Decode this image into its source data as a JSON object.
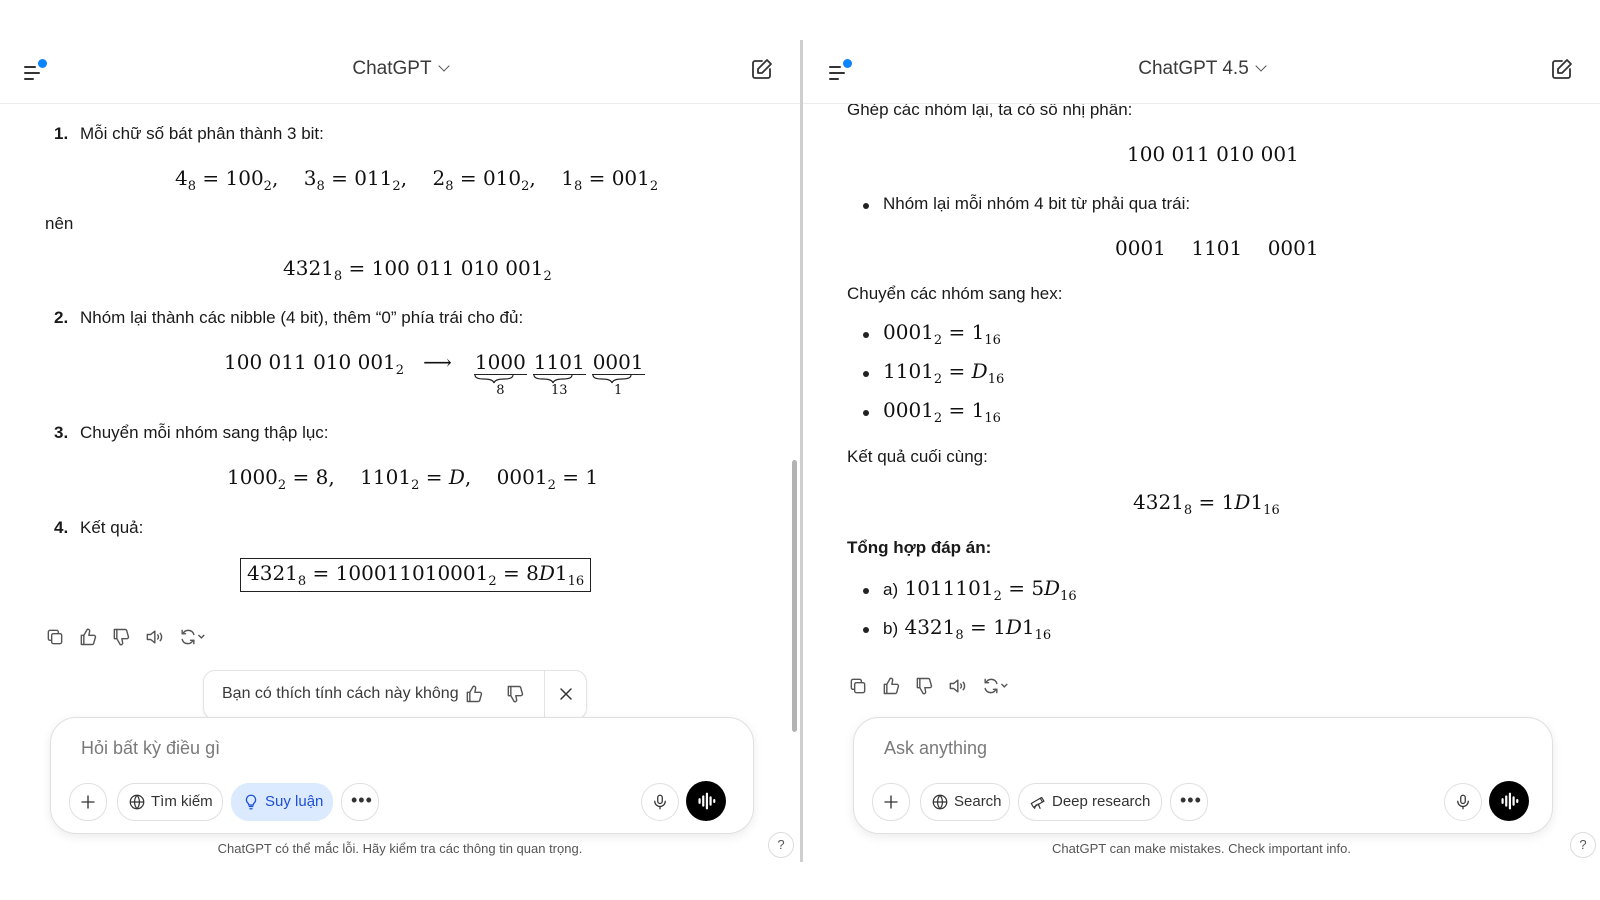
{
  "left": {
    "model": "ChatGPT",
    "step1": {
      "num": "1.",
      "text": "Mỗi chữ số bát phân thành 3 bit:"
    },
    "nen": "nên",
    "step2": {
      "num": "2.",
      "text": "Nhóm lại thành các nibble (4 bit), thêm “0” phía trái cho đủ:"
    },
    "step3": {
      "num": "3.",
      "text": "Chuyển mỗi nhóm sang thập lục:"
    },
    "step4": {
      "num": "4.",
      "text": "Kết quả:"
    },
    "feedback_question": "Bạn có thích tính cách này không",
    "composer_placeholder": "Hỏi bất kỳ điều gì",
    "search_label": "Tìm kiếm",
    "reasoning_label": "Suy luận",
    "disclaimer": "ChatGPT có thể mắc lỗi. Hãy kiểm tra các thông tin quan trọng."
  },
  "right": {
    "model": "ChatGPT 4.5",
    "p1": "Ghép các nhóm lại, ta có số nhị phân:",
    "binary": "100 011 010 001",
    "bullet1": "Nhóm lại mỗi nhóm 4 bit từ phải qua trái:",
    "g1": "0001",
    "g2": "1101",
    "g3": "0001",
    "p2": "Chuyển các nhóm sang hex:",
    "p3": "Kết quả cuối cùng:",
    "summary_title": "Tổng hợp đáp án:",
    "a_prefix": "a)",
    "b_prefix": "b)",
    "composer_placeholder": "Ask anything",
    "search_label": "Search",
    "deep_label": "Deep research",
    "disclaimer": "ChatGPT can make mistakes. Check important info."
  },
  "help_label": "?"
}
